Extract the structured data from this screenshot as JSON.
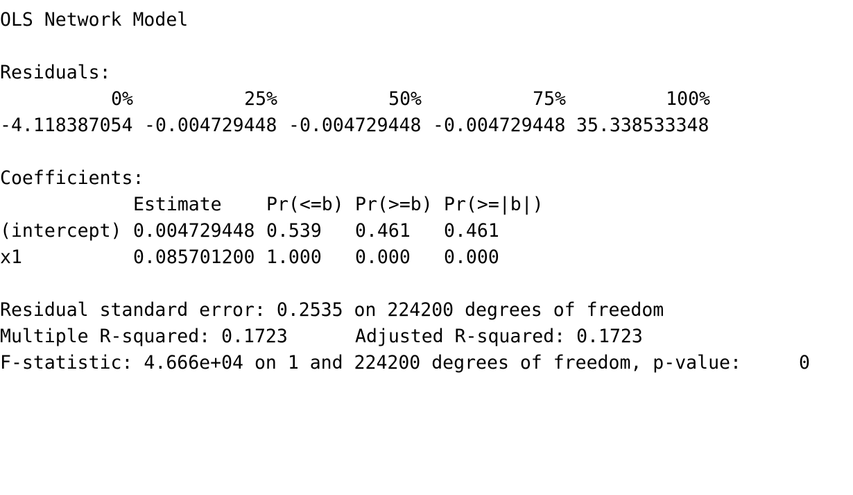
{
  "title": "OLS Network Model",
  "residuals": {
    "label": "Residuals:",
    "headers": [
      "0%",
      "25%",
      "50%",
      "75%",
      "100%"
    ],
    "values": [
      "-4.118387054",
      "-0.004729448",
      "-0.004729448",
      "-0.004729448",
      "35.338533348"
    ]
  },
  "coefficients": {
    "label": "Coefficients:",
    "headers": [
      "Estimate",
      "Pr(<=b)",
      "Pr(>=b)",
      "Pr(>=|b|)"
    ],
    "rows": [
      {
        "name": "(intercept)",
        "estimate": "0.004729448",
        "pr_le": "0.539",
        "pr_ge": "0.461",
        "pr_abs": "0.461"
      },
      {
        "name": "x1",
        "estimate": "0.085701200",
        "pr_le": "1.000",
        "pr_ge": "0.000",
        "pr_abs": "0.000"
      }
    ]
  },
  "summary": {
    "rse": "Residual standard error: 0.2535 on 224200 degrees of freedom",
    "multiple_r2": "Multiple R-squared: 0.1723",
    "adjusted_r2": "Adjusted R-squared: 0.1723",
    "fstat": "F-statistic: 4.666e+04 on 1 and 224200 degrees of freedom, p-value:",
    "pvalue": "0"
  }
}
